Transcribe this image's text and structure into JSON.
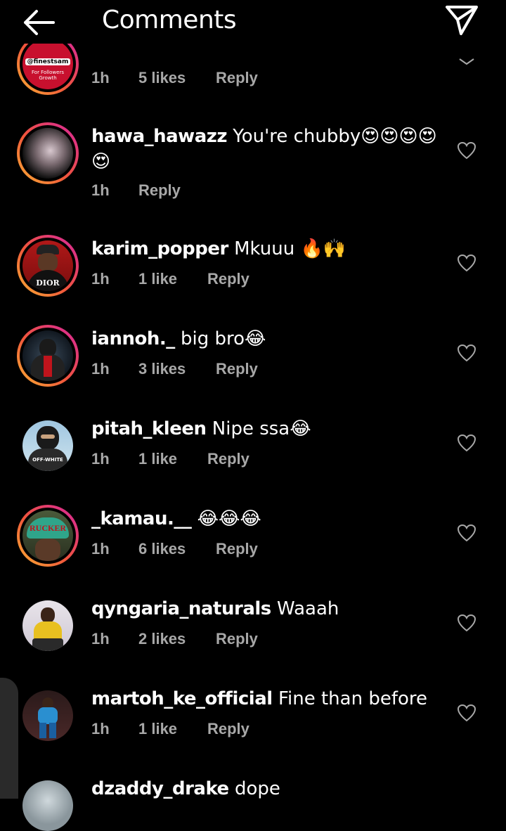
{
  "header": {
    "title": "Comments",
    "back_icon": "arrow-left-icon",
    "share_icon": "paper-plane-icon"
  },
  "top_partial": {
    "badge_line1": "@finestsam",
    "badge_line2": "For Followers",
    "badge_line3": "Growth",
    "time": "1h",
    "likes": "5 likes",
    "reply": "Reply"
  },
  "comments": [
    {
      "username": "hawa_hawazz",
      "text": "You're chubby😍😍😍😍",
      "text2": "😍",
      "time": "1h",
      "likes": "",
      "reply": "Reply"
    },
    {
      "username": "karim_popper",
      "text": "Mkuuu 🔥🙌",
      "time": "1h",
      "likes": "1 like",
      "reply": "Reply"
    },
    {
      "username": "iannoh._",
      "text": "big bro😂",
      "time": "1h",
      "likes": "3 likes",
      "reply": "Reply"
    },
    {
      "username": "pitah_kleen",
      "text": "Nipe ssa😂",
      "time": "1h",
      "likes": "1 like",
      "reply": "Reply"
    },
    {
      "username": "_kamau.__",
      "text": "😂😂😂",
      "time": "1h",
      "likes": "6 likes",
      "reply": "Reply"
    },
    {
      "username": "qyngaria_naturals",
      "text": "Waaah",
      "time": "1h",
      "likes": "2 likes",
      "reply": "Reply"
    },
    {
      "username": "martoh_ke_official",
      "text": "Fine than before",
      "time": "1h",
      "likes": "1 like",
      "reply": "Reply"
    },
    {
      "username": "dzaddy_drake",
      "text": "dope"
    }
  ],
  "avatar_labels": {
    "karim": "DIOR",
    "pitah": "OFF-WHITE",
    "kamau": "RUCKER"
  },
  "colors": {
    "background": "#000000",
    "meta_text": "#a8a8a8",
    "ring_start": "#f9b233",
    "ring_end": "#d6249f"
  }
}
